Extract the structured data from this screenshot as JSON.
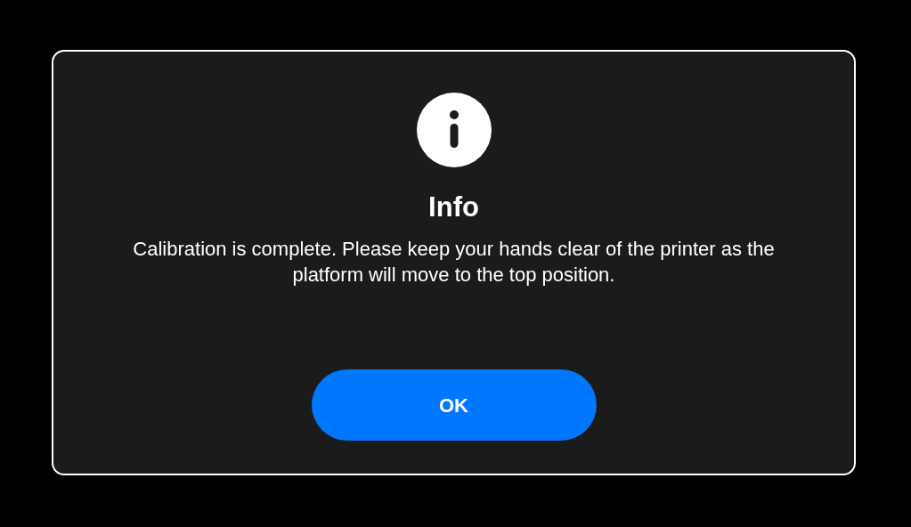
{
  "dialog": {
    "title": "Info",
    "message": "Calibration is complete. Please keep your hands clear of the printer as the platform will move to the top position.",
    "buttons": [
      "OK"
    ]
  }
}
